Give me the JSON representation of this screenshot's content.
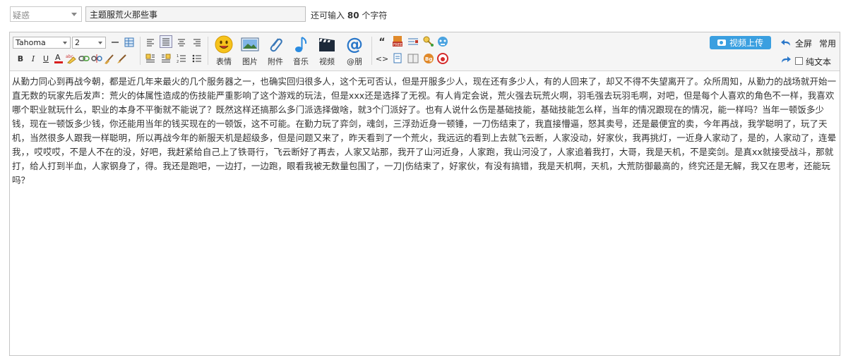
{
  "title_row": {
    "category_value": "疑惑",
    "subject_value": "主题服荒火那些事",
    "char_limit_prefix": "还可输入",
    "char_limit_count": "80",
    "char_limit_suffix": "个字符"
  },
  "toolbar": {
    "font_family": "Tahoma",
    "font_size": "2",
    "buttons": {
      "emoji": "表情",
      "image": "图片",
      "attachment": "附件",
      "music": "音乐",
      "video": "视频",
      "mention": "@朋"
    },
    "video_upload": "视频上传",
    "fullscreen": "全屏",
    "common": "常用",
    "plain_text": "纯文本"
  },
  "content": {
    "text": "从勤力同心到再战今朝，都是近几年来最火的几个服务器之一，也确实回归很多人，这个无可否认，但是开服多少人，现在还有多少人，有的人回来了，却又不得不失望离开了。众所周知，从勤力的战场就开始一直无数的玩家先后发声：荒火的体属性造成的伤技能严重影响了这个游戏的玩法，但是xxx还是选择了无视。有人肯定会说，荒火强去玩荒火啊，羽毛强去玩羽毛啊，对吧，但是每个人喜欢的角色不一样，我喜欢哪个职业就玩什么，职业的本身不平衡就不能说了？既然这样还搞那么多门派选择做啥，就3个门派好了。也有人说什么伤是基础技能，基础技能怎么样，当年的情况跟现在的情况，能一样吗？当年一顿饭多少钱，现在一顿饭多少钱，你还能用当年的钱买现在的一顿饭，这不可能。在勤力玩了弈剑，魂剑，三浮劲近身一顿锤，一刀伤结束了，我直接懵逼，怒其卖号，还是最便宜的卖，今年再战，我学聪明了，玩了天机，当然很多人跟我一样聪明，所以再战今年的新服天机是超级多，但是问题又来了，昨天看到了一个荒火，我远远的看到上去就飞云断，人家没动，好家伙，我再挑灯，一近身人家动了，是的，人家动了，连晕我，，哎哎哎，不是人不在的没，好吧，我赶紧给自己上了铁哥行，飞云断好了再去，人家又站那，我开了山河近身，人家跑，我山河没了，人家追着我打，大哥，我是天机，不是奕剑。是真xx就接受战斗，那就打，给人打到半血，人家钢身了，得。我还是跑吧，一边打，一边跑，眼看我被无数量包围了，一刀|伤结束了，好家伙，有没有搞错，我是天机啊，天机，大荒防御最高的，终究还是无解，我又在思考，还能玩吗？"
  }
}
